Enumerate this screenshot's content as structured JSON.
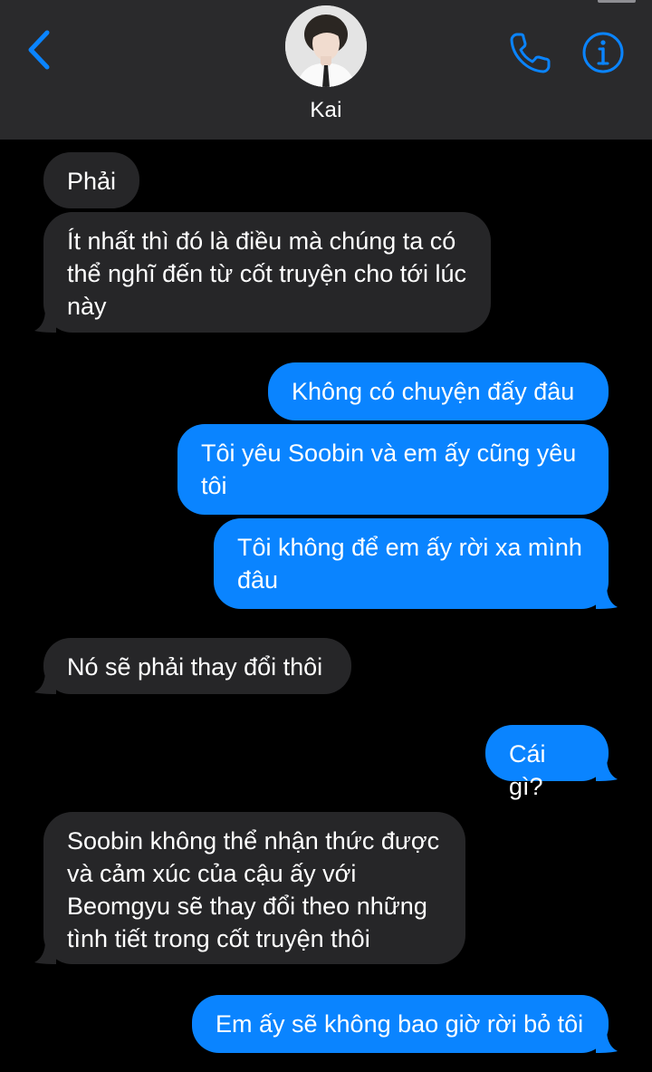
{
  "header": {
    "contact_name": "Kai",
    "back_icon": "chevron-left-icon",
    "call_icon": "phone-icon",
    "info_icon": "info-icon",
    "accent_color": "#0a84ff",
    "background_color": "#2a2a2c"
  },
  "colors": {
    "incoming_bubble": "#262628",
    "outgoing_bubble": "#0a84ff",
    "background": "#000000"
  },
  "messages": [
    {
      "direction": "incoming",
      "text": "Phải"
    },
    {
      "direction": "incoming",
      "text": "Ít nhất thì đó là điều mà chúng ta có thể nghĩ đến từ cốt truyện cho tới lúc này"
    },
    {
      "direction": "outgoing",
      "text": "Không có chuyện đấy đâu"
    },
    {
      "direction": "outgoing",
      "text": "Tôi yêu Soobin và em ấy cũng yêu tôi"
    },
    {
      "direction": "outgoing",
      "text": "Tôi không để em ấy rời xa mình đâu"
    },
    {
      "direction": "incoming",
      "text": "Nó sẽ phải thay đổi thôi"
    },
    {
      "direction": "outgoing",
      "text": "Cái gì?"
    },
    {
      "direction": "incoming",
      "text": "Soobin không thể nhận thức được và cảm xúc của cậu ấy với Beomgyu sẽ thay đổi theo những tình tiết trong cốt truyện thôi"
    },
    {
      "direction": "outgoing",
      "text": "Em ấy sẽ không bao giờ rời bỏ tôi"
    }
  ]
}
